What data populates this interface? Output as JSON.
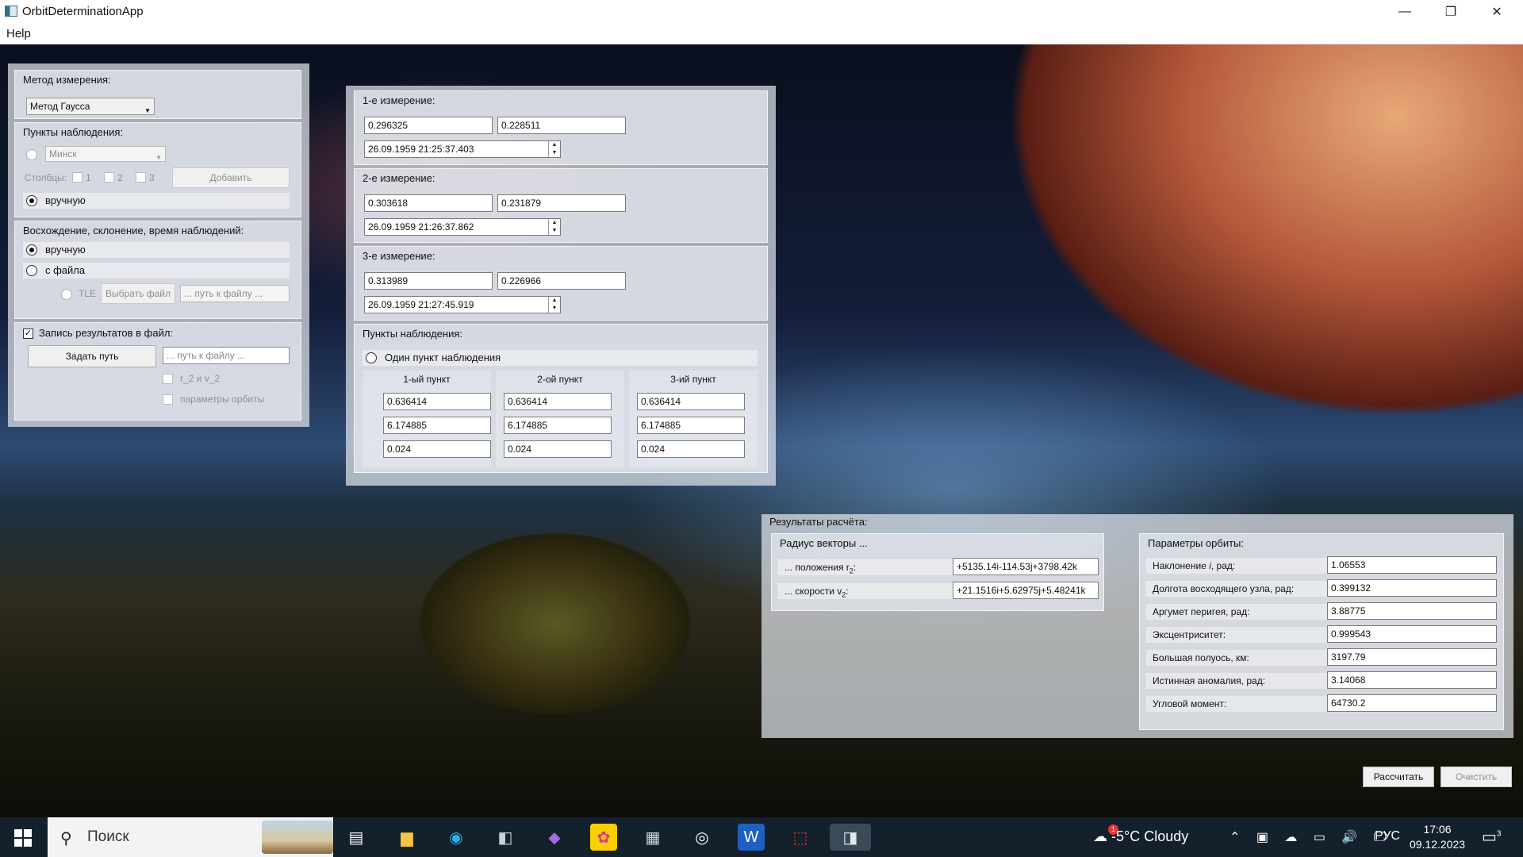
{
  "window": {
    "title": "OrbitDeterminationApp",
    "minimize_glyph": "—",
    "maximize_glyph": "❐",
    "close_glyph": "✕"
  },
  "menu": {
    "help": "Help"
  },
  "left": {
    "method": {
      "title": "Метод измерения:",
      "selected": "Метод Гаусса"
    },
    "stations": {
      "title": "Пункты наблюдения:",
      "city": "Минск",
      "columns_label": "Столбцы:",
      "col1": "1",
      "col2": "2",
      "col3": "3",
      "add_button": "Добавить",
      "manual": "вручную"
    },
    "ra_dec": {
      "title": "Восхождение, склонение, время наблюдений:",
      "manual": "вручную",
      "from_file": "с файла",
      "tle": "TLE",
      "choose_file": "Выбрать файл",
      "path_placeholder": "... путь к файлу ..."
    },
    "record": {
      "title": "Запись результатов в файл:",
      "checked_glyph": "✓",
      "set_path": "Задать путь",
      "path_placeholder": "... путь к файлу ...",
      "opt1": "r_2 и v_2",
      "opt2": "параметры орбиты"
    }
  },
  "measurements": [
    {
      "title": "1-е измерение:",
      "v1": "0.296325",
      "v2": "0.228511",
      "time": "26.09.1959 21:25:37.403"
    },
    {
      "title": "2-е измерение:",
      "v1": "0.303618",
      "v2": "0.231879",
      "time": "26.09.1959 21:26:37.862"
    },
    {
      "title": "3-е измерение:",
      "v1": "0.313989",
      "v2": "0.226966",
      "time": "26.09.1959 21:27:45.919"
    }
  ],
  "obs_points": {
    "title": "Пункты наблюдения:",
    "single": "Один пункт наблюдения",
    "columns": [
      {
        "header": "1-ый пункт",
        "a": "0.636414",
        "b": "6.174885",
        "c": "0.024"
      },
      {
        "header": "2-ой пункт",
        "a": "0.636414",
        "b": "6.174885",
        "c": "0.024"
      },
      {
        "header": "3-ий пункт",
        "a": "0.636414",
        "b": "6.174885",
        "c": "0.024"
      }
    ]
  },
  "results": {
    "title": "Результаты расчёта:",
    "radius": {
      "title": "Радиус векторы ...",
      "pos_label": "... положения r",
      "pos_sub": "2",
      "pos_value": "+5135.14i-114.53j+3798.42k",
      "vel_label": "... скорости v",
      "vel_sub": "2",
      "vel_value": "+21.1516i+5.62975j+5.48241k"
    },
    "orbit": {
      "title": "Параметры орбиты:",
      "rows": [
        {
          "label": "Наклонение ",
          "italic": "i",
          "label_tail": ", рад:",
          "value": "1.06553"
        },
        {
          "label": "Долгота восходящего узла, рад:",
          "italic": "",
          "label_tail": "",
          "value": "0.399132"
        },
        {
          "label": "Аргумет перигея, рад:",
          "italic": "",
          "label_tail": "",
          "value": "3.88775"
        },
        {
          "label": "Эксцентриситет:",
          "italic": "",
          "label_tail": "",
          "value": "0.999543"
        },
        {
          "label": "Большая полуось, км:",
          "italic": "",
          "label_tail": "",
          "value": "3197.79"
        },
        {
          "label": "Истинная аномалия, рад:",
          "italic": "",
          "label_tail": "",
          "value": "3.14068"
        },
        {
          "label": "Угловой момент:",
          "italic": "",
          "label_tail": "",
          "value": "64730.2"
        }
      ]
    }
  },
  "actions": {
    "calculate": "Рассчитать",
    "clear": "Очистить"
  },
  "taskbar": {
    "search": "Поиск",
    "weather": "-5°C  Cloudy",
    "weather_badge": "1",
    "tray": "⌃ ▣ ☁ ▭ 🔊 🖵",
    "lang": "РУС",
    "time": "17:06",
    "date": "09.12.2023",
    "notif_count": "3"
  }
}
